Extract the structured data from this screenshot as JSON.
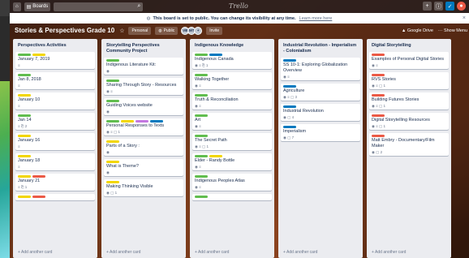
{
  "header": {
    "boards_label": "Boards",
    "logo": "Trello"
  },
  "notice": {
    "text": "This board is set to public. You can change its visibility at any time.",
    "link": "Learn more here"
  },
  "board": {
    "title": "Stories & Perspectives Grade 10",
    "team": "Personal",
    "visibility": "Public",
    "members": [
      "VB",
      "MT",
      "+"
    ],
    "invite": "Invite",
    "google_drive": "Google Drive",
    "show_menu": "Show Menu"
  },
  "label_colors": {
    "green": "#61bd4f",
    "yellow": "#f2d600",
    "red": "#eb5a46",
    "blue": "#0079bf",
    "purple": "#c377e0",
    "pink": "#ff78cb",
    "sky": "#00c2e0"
  },
  "add_card_label": "+ Add another card",
  "lists": [
    {
      "title": "Perspectives Activities",
      "cards": [
        {
          "labels": [
            "green",
            "yellow"
          ],
          "title": "January 7, 2019",
          "badges": "≡"
        },
        {
          "labels": [
            "green"
          ],
          "title": "Jan 8, 2018",
          "badges": "≡"
        },
        {
          "labels": [
            "yellow"
          ],
          "title": "January 10",
          "badges": "≡"
        },
        {
          "labels": [
            "green"
          ],
          "title": "Jan 14",
          "badges": "≡  ⎘ 2"
        },
        {
          "labels": [
            "yellow"
          ],
          "title": "January 16",
          "badges": "≡"
        },
        {
          "labels": [
            "yellow"
          ],
          "title": "January 18",
          "badges": "≡"
        },
        {
          "labels": [
            "yellow",
            "red"
          ],
          "title": "January 21",
          "badges": "≡  ⎘ 1"
        },
        {
          "labels": [
            "yellow",
            "red"
          ],
          "title": "",
          "badges": ""
        }
      ]
    },
    {
      "title": "Storytelling Perspectives Community Project",
      "cards": [
        {
          "labels": [
            "green"
          ],
          "title": "Indigenous Literature Kit:",
          "badges": "◉"
        },
        {
          "labels": [
            "green"
          ],
          "title": "Sharing Through Story - Resources",
          "badges": "◉  ≡"
        },
        {
          "labels": [
            "green"
          ],
          "title": "Guiding Voices website",
          "badges": "◉"
        },
        {
          "labels": [
            "green",
            "yellow",
            "purple",
            "blue"
          ],
          "title": "Personal Responses to Texts",
          "badges": "◉  ≡  ▢ 1"
        },
        {
          "labels": [
            "yellow"
          ],
          "title": "Parts of a Story :",
          "badges": "◉"
        },
        {
          "labels": [
            "yellow"
          ],
          "title": "What is Theme?",
          "badges": "◉"
        },
        {
          "labels": [
            "yellow"
          ],
          "title": "Making Thinking Visible",
          "badges": "◉  ▢ 1"
        }
      ]
    },
    {
      "title": "Indigenous Knowledge",
      "cards": [
        {
          "labels": [
            "green",
            "blue"
          ],
          "title": "Indigenous Canada",
          "badges": "◉  ≡  ⎘ 1"
        },
        {
          "labels": [
            "green"
          ],
          "title": "Walking Together",
          "badges": "◉  ≡"
        },
        {
          "labels": [
            "green"
          ],
          "title": "Truth & Reconciliation",
          "badges": "◉  ≡"
        },
        {
          "labels": [
            "green"
          ],
          "title": "Art",
          "badges": "◉  ≡"
        },
        {
          "labels": [
            "green"
          ],
          "title": "The Secret Path",
          "badges": "◉  ≡  ▢ 1"
        },
        {
          "labels": [
            "green",
            "yellow"
          ],
          "title": "Elder - Randy Bottle",
          "badges": "◉  ≡"
        },
        {
          "labels": [
            "green"
          ],
          "title": "Indigenous Peoples Atlas",
          "badges": "◉  ≡"
        },
        {
          "labels": [
            "green"
          ],
          "title": "",
          "badges": ""
        }
      ]
    },
    {
      "title": "Industrial Revolution - Imperialism - Colonialism",
      "cards": [
        {
          "labels": [
            "blue"
          ],
          "title": "SS 10-1: Exploring Globalization Overview",
          "badges": "◉  ≡"
        },
        {
          "labels": [
            "blue"
          ],
          "title": "Agriculture",
          "badges": "◉  ≡  ▢ 3"
        },
        {
          "labels": [
            "blue"
          ],
          "title": "Industrial Revolution",
          "badges": "◉  ▢ 4"
        },
        {
          "labels": [
            "blue"
          ],
          "title": "Imperialism",
          "badges": "◉  ▢ 7"
        }
      ]
    },
    {
      "title": "Digital Storytelling",
      "cards": [
        {
          "labels": [
            "red"
          ],
          "title": "Examples of Personal Digital Stories",
          "badges": "◉  ≡"
        },
        {
          "labels": [
            "red"
          ],
          "title": "RVS Stories",
          "badges": "◉  ≡  ▢ 1"
        },
        {
          "labels": [
            "red"
          ],
          "title": "Building Futures Stories",
          "badges": "◉  ≡  ▢ 1"
        },
        {
          "labels": [
            "red"
          ],
          "title": "Digital Storytelling Resources",
          "badges": "◉  ≡  ▢ 1"
        },
        {
          "labels": [
            "red"
          ],
          "title": "Matt Embry - Documentary/Film Maker",
          "badges": "◉  ▢ 2"
        }
      ]
    }
  ]
}
